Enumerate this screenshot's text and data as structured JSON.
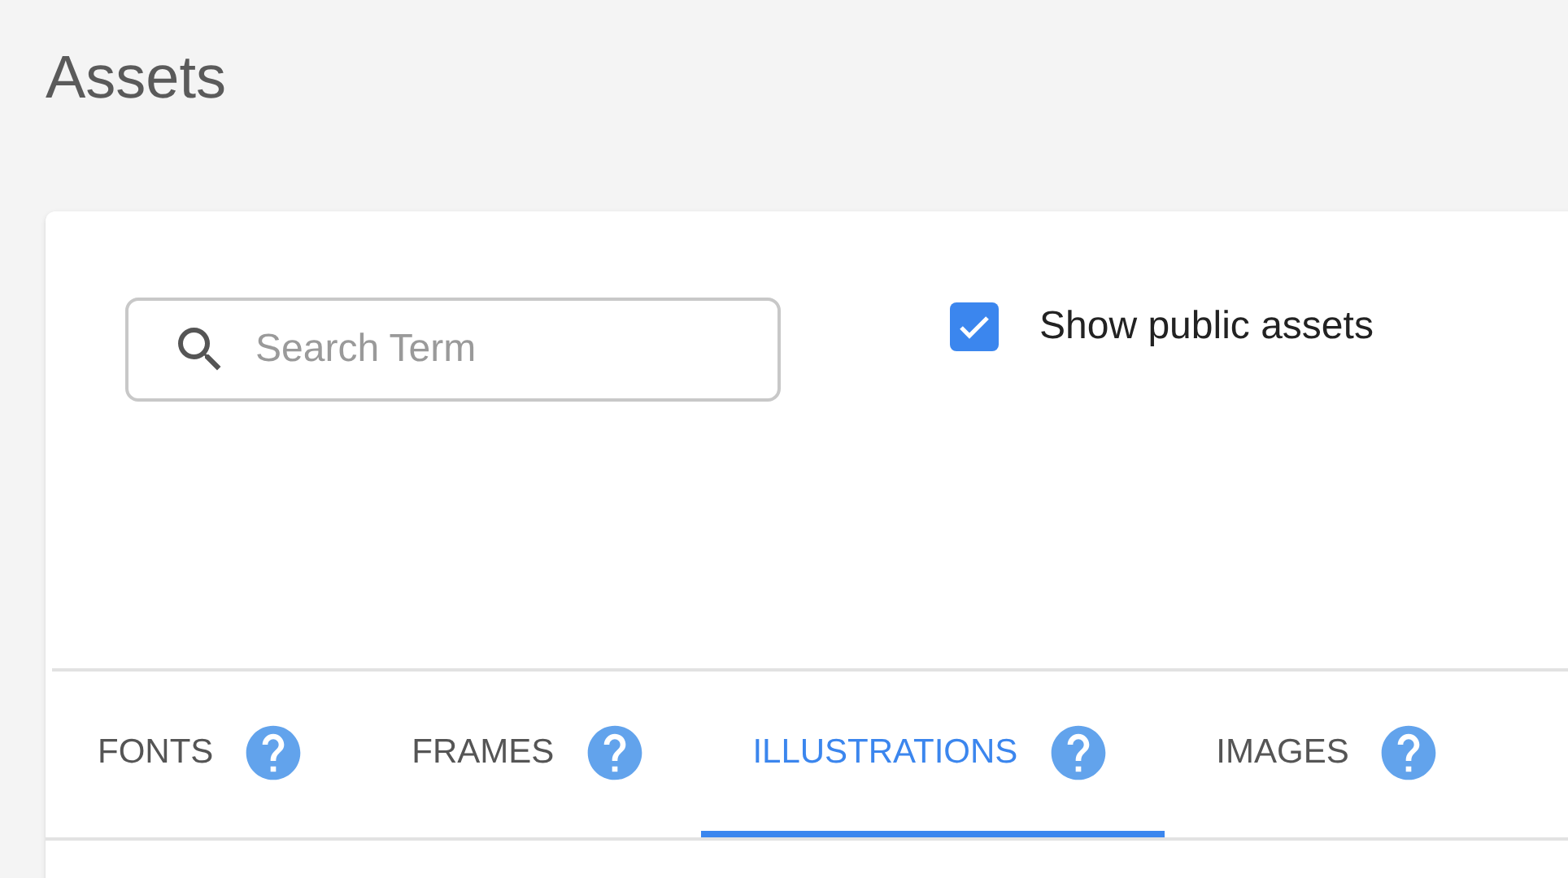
{
  "page": {
    "title": "Assets"
  },
  "search": {
    "placeholder": "Search Term"
  },
  "public_assets": {
    "label": "Show public assets",
    "checked": true
  },
  "tabs": [
    {
      "label": "FONTS",
      "selected": false
    },
    {
      "label": "FRAMES",
      "selected": false
    },
    {
      "label": "ILLUSTRATIONS",
      "selected": true
    },
    {
      "label": "IMAGES",
      "selected": false
    }
  ]
}
